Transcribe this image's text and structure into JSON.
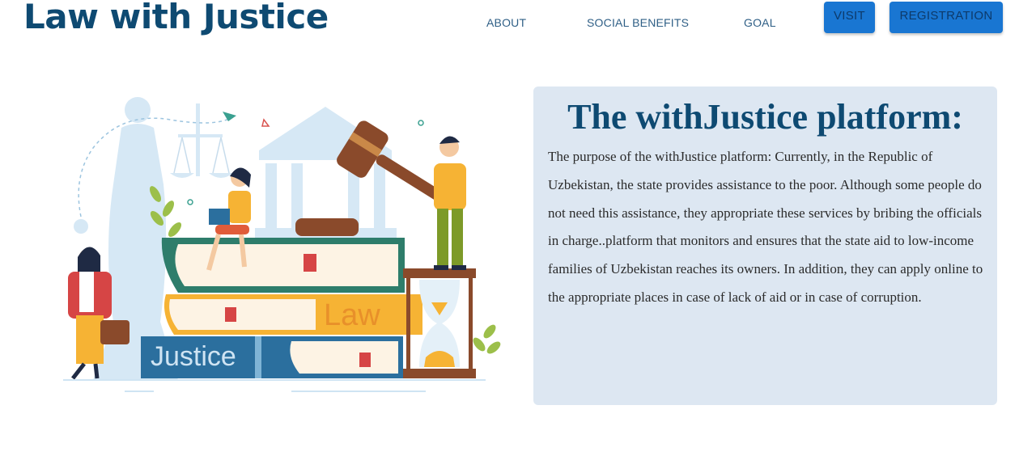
{
  "header": {
    "brand": "Law with Justice",
    "nav": [
      {
        "label": "ABOUT"
      },
      {
        "label": "SOCIAL BENEFITS"
      },
      {
        "label": "GOAL"
      }
    ],
    "buttons": {
      "visit": "VISIT",
      "registration": "REGISTRATION"
    }
  },
  "illustration": {
    "book_labels": {
      "law": "Law",
      "justice": "Justice"
    }
  },
  "panel": {
    "title": "The withJustice platform:",
    "text": "The purpose of the withJustice platform: Currently, in the Republic of Uzbekistan, the state provides assistance to the poor. Although some people do not need this assistance, they appropriate these services by bribing the officials in charge..platform that monitors and ensures that the state aid to low-income families of Uzbekistan reaches its owners. In addition, they can apply online to the appropriate places in case of lack of aid or in case of corruption."
  },
  "colors": {
    "brand": "#0e4a72",
    "nav_text": "#2f5f86",
    "button_bg": "#1976d2",
    "panel_bg": "#dde7f2"
  }
}
